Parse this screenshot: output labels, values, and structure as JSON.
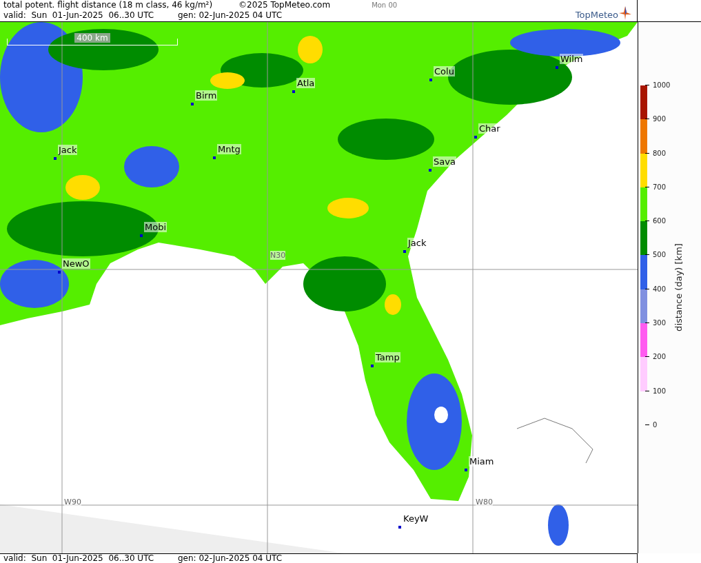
{
  "header": {
    "title": "total potent. flight distance (18 m class, 46 kg/m²)",
    "copyright": "©2025 TopMeteo.com",
    "forecast_slot": "Mon 00",
    "valid": "valid:  Sun  01-Jun-2025  06..30 UTC",
    "generated": "gen: 02-Jun-2025 04 UTC",
    "logo": "TopMeteo"
  },
  "map": {
    "scale": "400 km",
    "cities": [
      "Wilm",
      "Colu",
      "Atla",
      "Birm",
      "Char",
      "Jack",
      "Mntg",
      "Sava",
      "Mobi",
      "Jack",
      "NewO",
      "Tamp",
      "Miam",
      "KeyW"
    ],
    "grid_labels": [
      "N30",
      "W90",
      "W80"
    ]
  },
  "legend": {
    "title": "distance (day) [km]",
    "ticks": [
      "1000",
      "900",
      "800",
      "700",
      "600",
      "500",
      "400",
      "300",
      "200",
      "100",
      "0"
    ],
    "bands": [
      {
        "color": "#a81500"
      },
      {
        "color": "#ee7700"
      },
      {
        "color": "#ffdd00"
      },
      {
        "color": "#55ee00"
      },
      {
        "color": "#008c00"
      },
      {
        "color": "#3060e8"
      },
      {
        "color": "#8090e0"
      },
      {
        "color": "#ff5cf0"
      },
      {
        "color": "#ffccff"
      }
    ]
  },
  "footer": {
    "valid": "valid:  Sun  01-Jun-2025  06..30 UTC",
    "generated": "gen: 02-Jun-2025 04 UTC"
  }
}
